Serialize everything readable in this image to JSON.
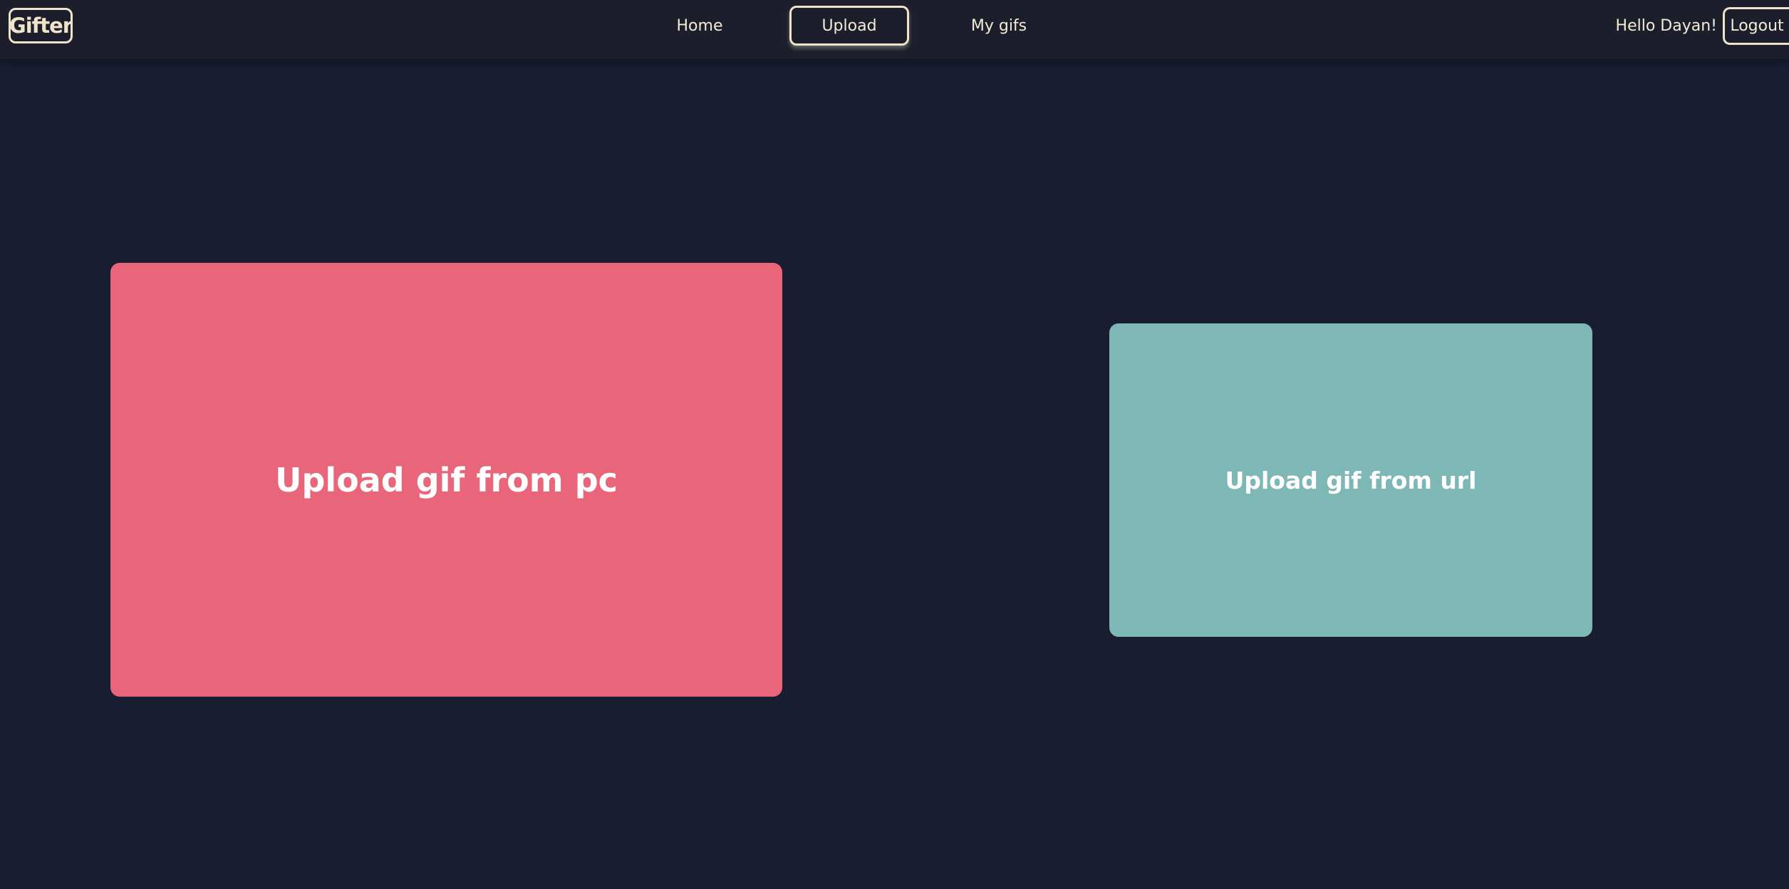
{
  "header": {
    "logo_text": "Gifter",
    "nav": {
      "home": "Home",
      "upload": "Upload",
      "my_gifs": "My gifs"
    },
    "greeting": "Hello Dayan!",
    "logout_label": "Logout"
  },
  "main": {
    "upload_pc_label": "Upload gif from pc",
    "upload_url_label": "Upload gif from url"
  },
  "colors": {
    "background": "#191d31",
    "navbar": "#1c1e2c",
    "accent_border": "#efe3c9",
    "upload_pc_card": "#e8657a",
    "upload_url_card": "#7eb8b6"
  }
}
